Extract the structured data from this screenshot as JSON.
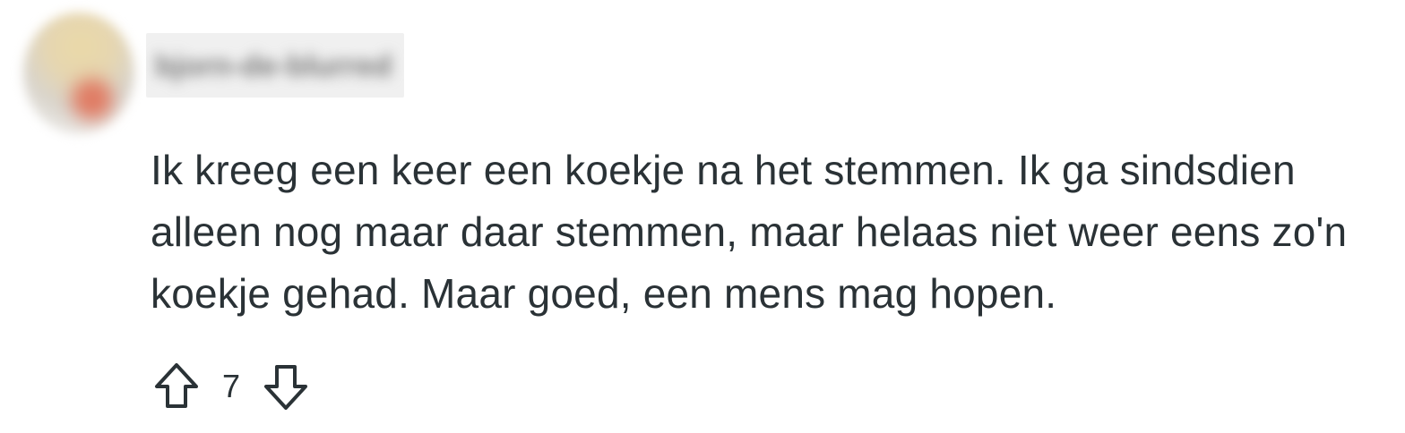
{
  "comment": {
    "author": "bjorn-de-blurred",
    "body": "Ik kreeg een keer een koekje na het stemmen. Ik ga sindsdien alleen nog maar daar stemmen, maar helaas niet weer eens zo'n koekje gehad. Maar goed, een mens mag hopen.",
    "vote_count": "7"
  },
  "icons": {
    "upvote": "arrow-up-icon",
    "downvote": "arrow-down-icon"
  },
  "colors": {
    "text": "#2a3236",
    "icon": "#2a3236",
    "background": "#ffffff"
  }
}
